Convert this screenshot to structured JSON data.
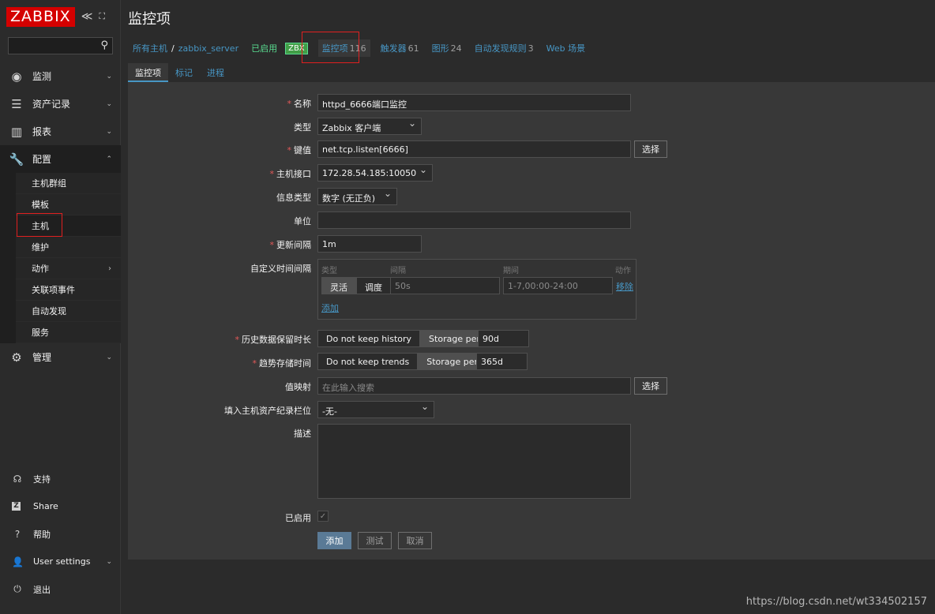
{
  "sidebar": {
    "logo": "ZABBIX",
    "collapse_glyph": "≪",
    "expand_glyph": "⛶",
    "menu": [
      {
        "label": "监测",
        "icon": "eye-icon"
      },
      {
        "label": "资产记录",
        "icon": "list-icon"
      },
      {
        "label": "报表",
        "icon": "bar-chart-icon"
      },
      {
        "label": "配置",
        "icon": "wrench-icon"
      }
    ],
    "config_sub": [
      {
        "label": "主机群组"
      },
      {
        "label": "模板"
      },
      {
        "label": "主机"
      },
      {
        "label": "维护"
      },
      {
        "label": "动作"
      },
      {
        "label": "关联项事件"
      },
      {
        "label": "自动发现"
      },
      {
        "label": "服务"
      }
    ],
    "admin": {
      "label": "管理",
      "icon": "gear-icon"
    },
    "bottom": [
      {
        "label": "支持",
        "icon": "headset-icon"
      },
      {
        "label": "Share",
        "icon": "share-icon"
      },
      {
        "label": "帮助",
        "icon": "help-icon"
      },
      {
        "label": "User settings",
        "icon": "user-icon"
      },
      {
        "label": "退出",
        "icon": "power-icon"
      }
    ]
  },
  "header": {
    "title": "监控项"
  },
  "breadcrumbs": {
    "all_hosts": "所有主机",
    "separator": "/",
    "host": "zabbix_server",
    "status": "已启用",
    "zbx": "ZBX",
    "items": {
      "label": "监控项",
      "count": "116"
    },
    "triggers": {
      "label": "触发器",
      "count": "61"
    },
    "graphs": {
      "label": "图形",
      "count": "24"
    },
    "discovery": {
      "label": "自动发现规则",
      "count": "3"
    },
    "web": {
      "label": "Web 场景"
    }
  },
  "tabs": [
    "监控项",
    "标记",
    "进程"
  ],
  "form": {
    "name": {
      "label": "名称",
      "value": "httpd_6666端口监控"
    },
    "type": {
      "label": "类型",
      "value": "Zabbix 客户端"
    },
    "key": {
      "label": "键值",
      "value": "net.tcp.listen[6666]",
      "button": "选择"
    },
    "interface": {
      "label": "主机接口",
      "value": "172.28.54.185:10050"
    },
    "info_type": {
      "label": "信息类型",
      "value": "数字 (无正负)"
    },
    "units": {
      "label": "单位",
      "value": ""
    },
    "update_interval": {
      "label": "更新间隔",
      "value": "1m"
    },
    "custom_intervals": {
      "label": "自定义时间间隔",
      "col_type": "类型",
      "col_interval": "间隔",
      "col_period": "期间",
      "col_action": "动作",
      "flex": "灵活",
      "sched": "调度",
      "interval_ph": "50s",
      "period_ph": "1-7,00:00-24:00",
      "remove": "移除",
      "add": "添加"
    },
    "history": {
      "label": "历史数据保留时长",
      "opt1": "Do not keep history",
      "opt2": "Storage period",
      "value": "90d"
    },
    "trends": {
      "label": "趋势存储时间",
      "opt1": "Do not keep trends",
      "opt2": "Storage period",
      "value": "365d"
    },
    "valuemap": {
      "label": "值映射",
      "placeholder": "在此输入搜索",
      "button": "选择"
    },
    "inventory": {
      "label": "填入主机资产纪录栏位",
      "value": "-无-"
    },
    "description": {
      "label": "描述"
    },
    "enabled": {
      "label": "已启用",
      "checked": true,
      "check_glyph": "✓"
    },
    "buttons": {
      "add": "添加",
      "test": "测试",
      "cancel": "取消"
    }
  },
  "watermark": "https://blog.csdn.net/wt334502157",
  "colors": {
    "accent": "#4796c4",
    "danger": "#d40000",
    "enabled": "#59db8f",
    "bg": "#2b2b2b",
    "panel": "#383838"
  }
}
